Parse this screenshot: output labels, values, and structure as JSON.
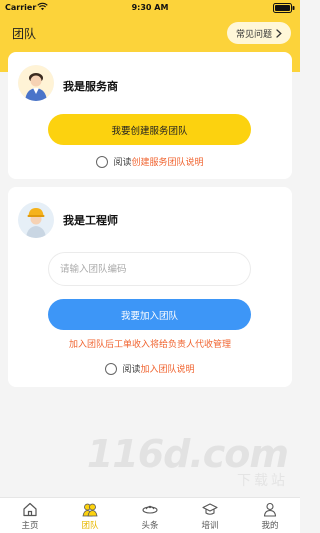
{
  "status_bar": {
    "carrier": "Carrier",
    "time": "9:30 AM"
  },
  "header": {
    "title": "团队",
    "faq_label": "常见问题"
  },
  "provider_card": {
    "title": "我是服务商",
    "button_label": "我要创建服务团队",
    "agree_prefix": "阅读",
    "agree_link": "创建服务团队说明"
  },
  "engineer_card": {
    "title": "我是工程师",
    "input_placeholder": "请输入团队编码",
    "input_value": "",
    "button_label": "我要加入团队",
    "notice": "加入团队后工单收入将给负责人代收管理",
    "agree_prefix": "阅读",
    "agree_link": "加入团队说明"
  },
  "watermark": {
    "main": "116d.com",
    "sub": "下载站"
  },
  "tabbar": {
    "items": [
      {
        "label": "主页",
        "icon": "home-icon"
      },
      {
        "label": "团队",
        "icon": "team-icon",
        "active": true
      },
      {
        "label": "头条",
        "icon": "headlines-icon"
      },
      {
        "label": "培训",
        "icon": "training-icon"
      },
      {
        "label": "我的",
        "icon": "profile-icon"
      }
    ]
  },
  "colors": {
    "brand_yellow": "#fcd33a",
    "button_yellow": "#fcd20f",
    "button_blue": "#3d96f7",
    "accent_red": "#f0632f",
    "active_tab": "#e8b800"
  }
}
